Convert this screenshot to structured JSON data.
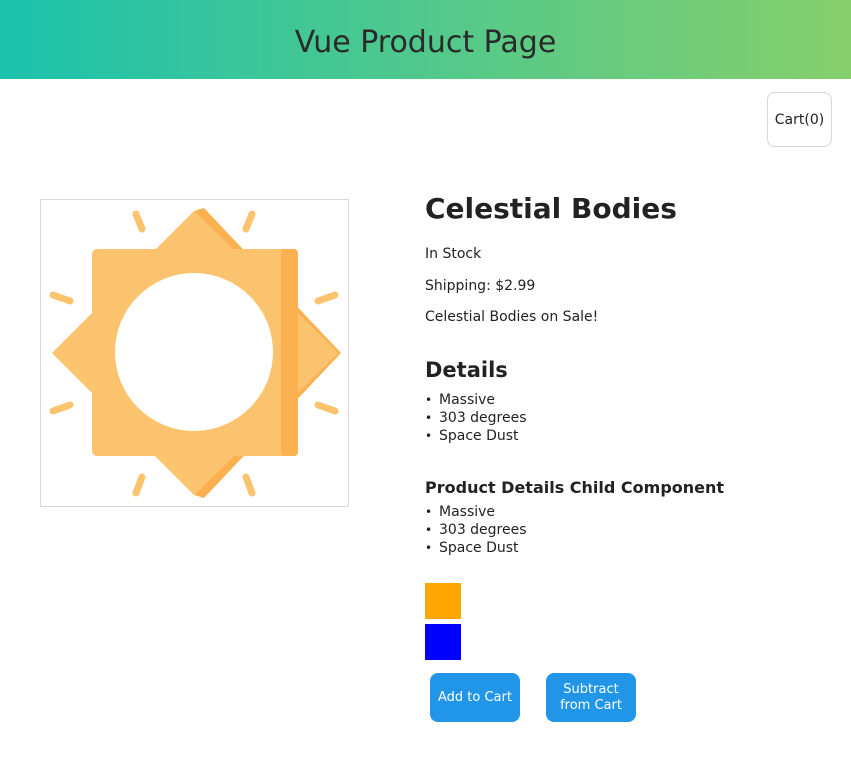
{
  "header": {
    "title": "Vue Product Page"
  },
  "cart": {
    "label": "Cart(0)"
  },
  "product": {
    "title": "Celestial Bodies",
    "stock_status": "In Stock",
    "shipping": "Shipping: $2.99",
    "sale_message": "Celestial Bodies on Sale!",
    "image_icon": "sun-icon"
  },
  "details": {
    "heading": "Details",
    "items": [
      "Massive",
      "303 degrees",
      "Space Dust"
    ]
  },
  "child_details": {
    "heading": "Product Details Child Component",
    "items": [
      "Massive",
      "303 degrees",
      "Space Dust"
    ]
  },
  "variants": [
    {
      "color": "#ffa500"
    },
    {
      "color": "#0000ff"
    }
  ],
  "buttons": {
    "add_label": "Add to Cart",
    "subtract_line1": "Subtract",
    "subtract_line2": "from Cart"
  },
  "colors": {
    "header_gradient_start": "#1bc2ad",
    "header_gradient_end": "#86cf6b",
    "button": "#2196e8",
    "sun_light": "#fcc36e",
    "sun_dark": "#fbb14f"
  }
}
